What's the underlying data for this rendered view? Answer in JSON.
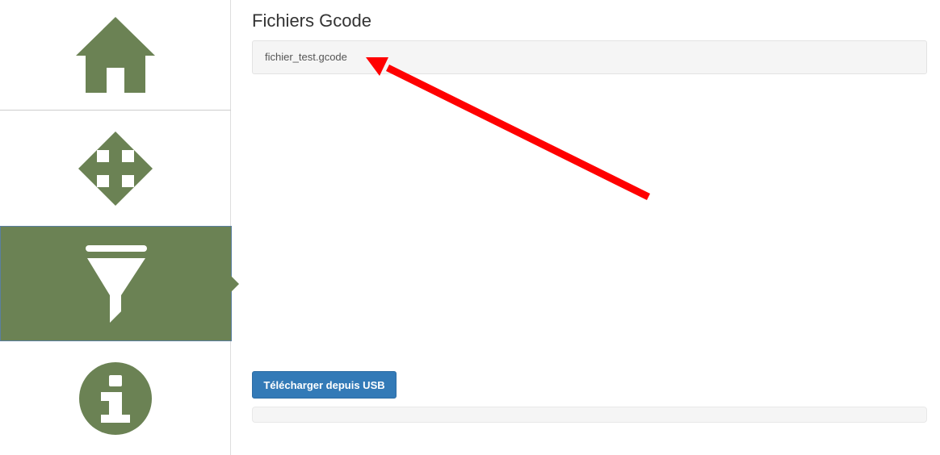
{
  "sidebar": {
    "items": [
      {
        "id": "home",
        "icon": "home-icon",
        "active": false
      },
      {
        "id": "move",
        "icon": "move-arrows-icon",
        "active": false
      },
      {
        "id": "filament",
        "icon": "funnel-icon",
        "active": true
      },
      {
        "id": "info",
        "icon": "info-icon",
        "active": false
      }
    ],
    "icon_color": "#6b8254",
    "active_bg": "#6b8254",
    "active_icon_color": "#ffffff"
  },
  "main": {
    "title": "Fichiers Gcode",
    "files": [
      "fichier_test.gcode"
    ],
    "upload_button_label": "Télécharger depuis USB",
    "upload_progress": 0
  },
  "annotation": {
    "type": "arrow",
    "color": "#ff0000",
    "target": "file-item"
  },
  "colors": {
    "accent": "#337ab7",
    "sidebar_green": "#6b8254",
    "annotation_red": "#ff0000"
  }
}
